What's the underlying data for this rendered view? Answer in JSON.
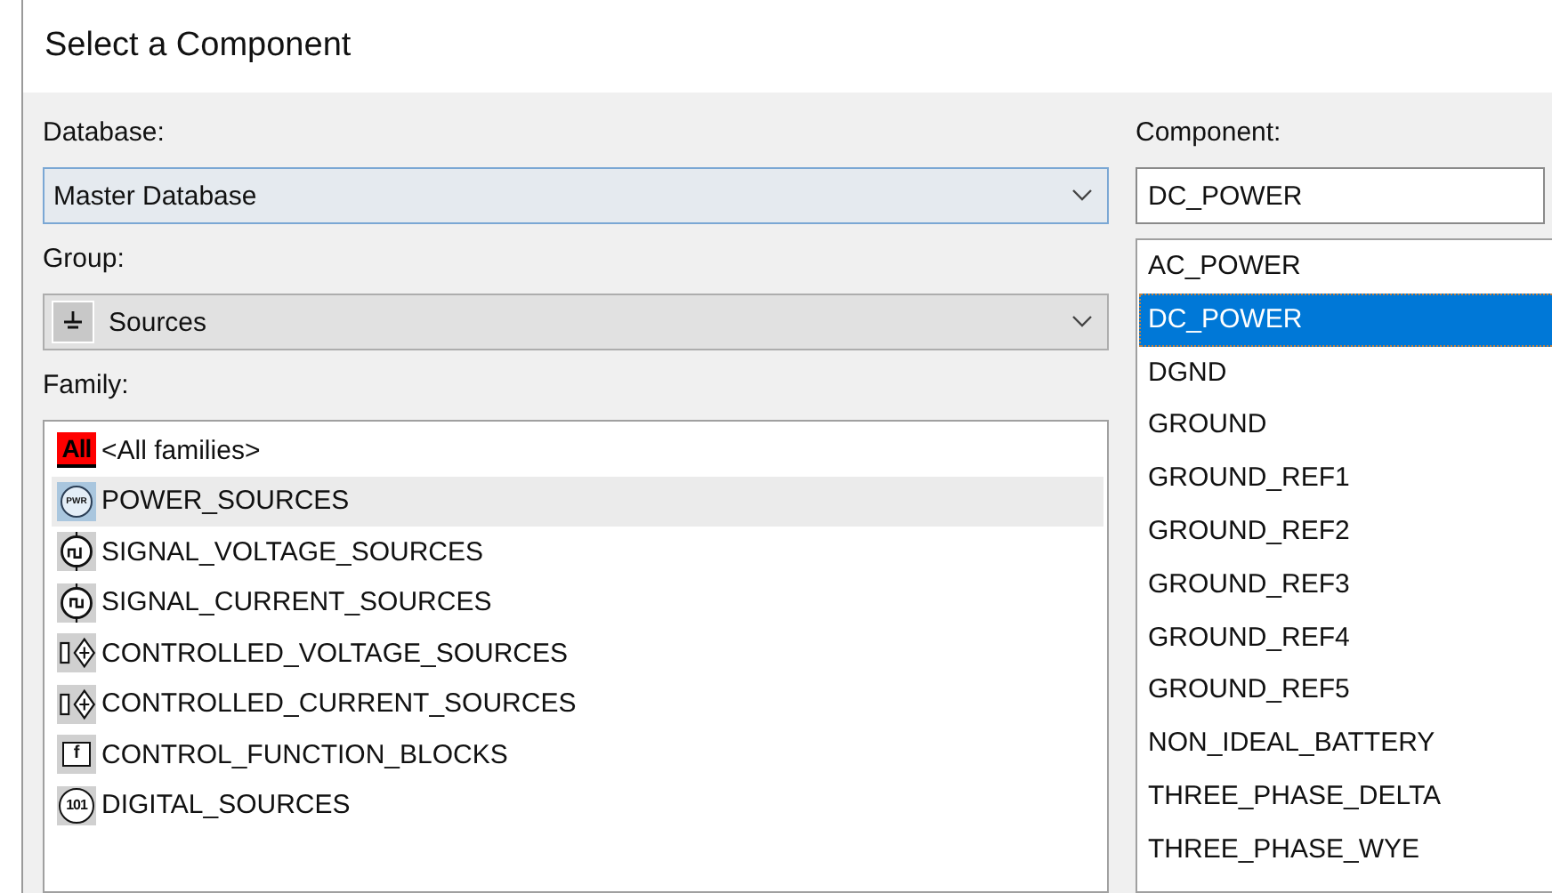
{
  "window": {
    "title": "Select a Component"
  },
  "database": {
    "label": "Database:",
    "value": "Master Database"
  },
  "group": {
    "label": "Group:",
    "value": "Sources"
  },
  "family": {
    "label": "Family:",
    "items": [
      {
        "label": "<All families>",
        "kind": "all",
        "icon_text": "All",
        "selected": false
      },
      {
        "label": "POWER_SOURCES",
        "kind": "power",
        "icon_text": "PWR",
        "selected": true
      },
      {
        "label": "SIGNAL_VOLTAGE_SOURCES",
        "kind": "signal-voltage",
        "selected": false
      },
      {
        "label": "SIGNAL_CURRENT_SOURCES",
        "kind": "signal-current",
        "selected": false
      },
      {
        "label": "CONTROLLED_VOLTAGE_SOURCES",
        "kind": "controlled",
        "selected": false
      },
      {
        "label": "CONTROLLED_CURRENT_SOURCES",
        "kind": "controlled",
        "selected": false
      },
      {
        "label": "CONTROL_FUNCTION_BLOCKS",
        "kind": "function",
        "icon_text": "f",
        "selected": false
      },
      {
        "label": "DIGITAL_SOURCES",
        "kind": "digital",
        "icon_text": "101",
        "selected": false
      }
    ]
  },
  "component": {
    "label": "Component:",
    "value": "DC_POWER",
    "items": [
      {
        "label": "AC_POWER",
        "selected": false
      },
      {
        "label": "DC_POWER",
        "selected": true
      },
      {
        "label": "DGND",
        "selected": false
      },
      {
        "label": "GROUND",
        "selected": false
      },
      {
        "label": "GROUND_REF1",
        "selected": false
      },
      {
        "label": "GROUND_REF2",
        "selected": false
      },
      {
        "label": "GROUND_REF3",
        "selected": false
      },
      {
        "label": "GROUND_REF4",
        "selected": false
      },
      {
        "label": "GROUND_REF5",
        "selected": false
      },
      {
        "label": "NON_IDEAL_BATTERY",
        "selected": false
      },
      {
        "label": "THREE_PHASE_DELTA",
        "selected": false
      },
      {
        "label": "THREE_PHASE_WYE",
        "selected": false
      }
    ]
  }
}
